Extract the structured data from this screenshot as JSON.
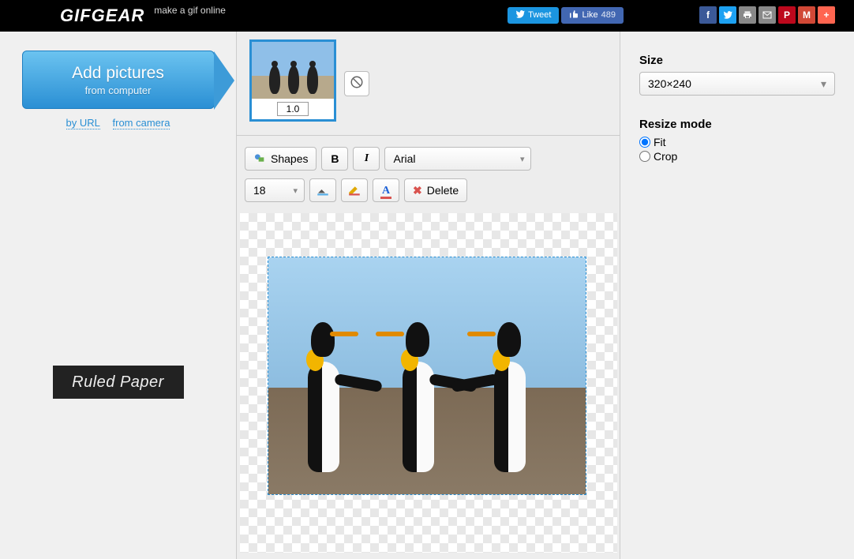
{
  "header": {
    "logo_prefix": "GIF",
    "logo_suffix": "GEAR",
    "tagline": "make a gif online",
    "tweet_label": "Tweet",
    "like_label": "Like",
    "like_count": "489"
  },
  "left": {
    "add_title": "Add pictures",
    "add_subtitle": "from computer",
    "link_url": "by URL",
    "link_camera": "from camera",
    "ad_label": "Ruled Paper"
  },
  "frames": {
    "frame0_duration": "1.0"
  },
  "toolbar": {
    "shapes_label": "Shapes",
    "font_family": "Arial",
    "font_size": "18",
    "delete_label": "Delete"
  },
  "right": {
    "size_label": "Size",
    "size_value": "320×240",
    "resize_label": "Resize mode",
    "fit_label": "Fit",
    "crop_label": "Crop"
  }
}
